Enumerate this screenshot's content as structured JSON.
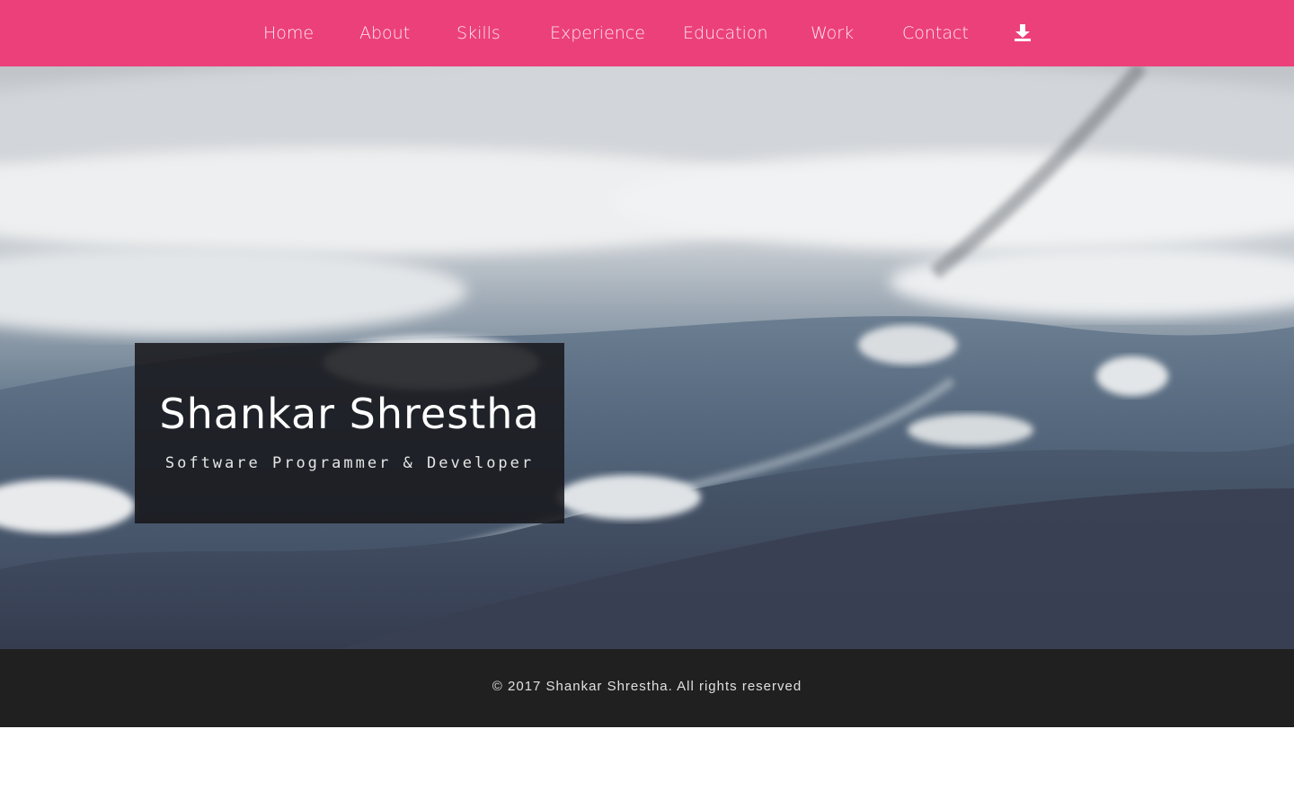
{
  "nav": {
    "items": [
      {
        "label": "Home"
      },
      {
        "label": "About"
      },
      {
        "label": "Skills"
      },
      {
        "label": "Experience"
      },
      {
        "label": "Education"
      },
      {
        "label": "Work"
      },
      {
        "label": "Contact"
      }
    ],
    "download_icon": "download-icon"
  },
  "hero": {
    "name": "Shankar Shrestha",
    "role": "Software Programmer & Developer"
  },
  "footer": {
    "copyright": "© 2017 Shankar Shrestha. All rights reserved"
  },
  "colors": {
    "nav_background": "#ec407a",
    "footer_background": "#202020",
    "intro_box": "#16161a"
  }
}
